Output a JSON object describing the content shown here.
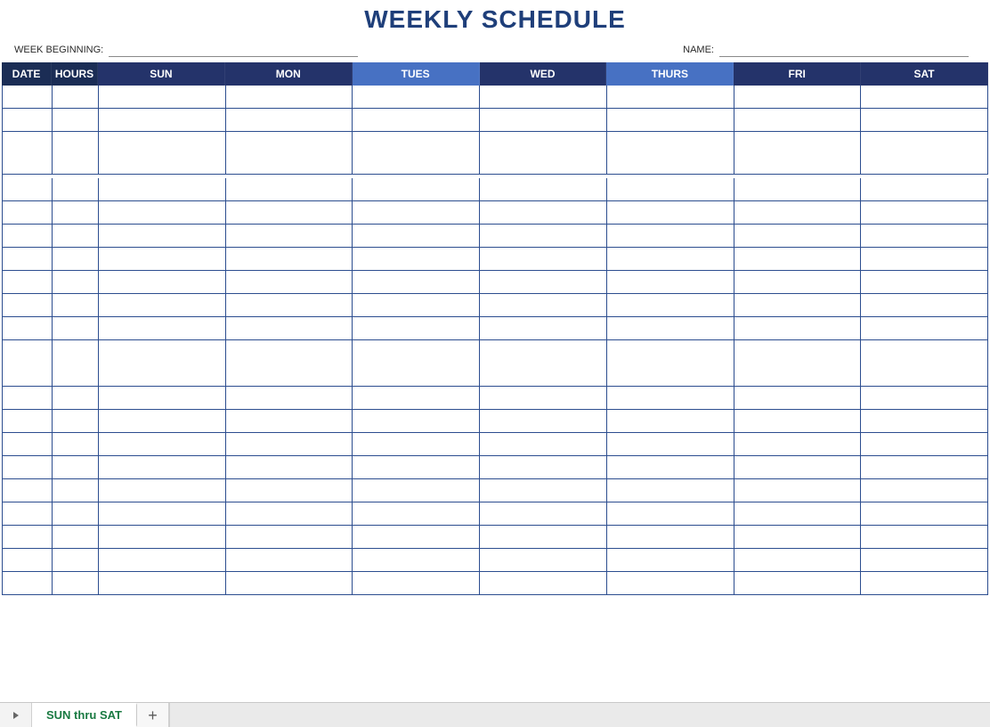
{
  "title": "WEEKLY SCHEDULE",
  "info": {
    "week_beginning_label": "WEEK BEGINNING:",
    "week_beginning_value": "",
    "name_label": "NAME:",
    "name_value": ""
  },
  "columns": {
    "date": "DATE",
    "hours": "HOURS",
    "sun": "SUN",
    "mon": "MON",
    "tues": "TUES",
    "wed": "WED",
    "thurs": "THURS",
    "fri": "FRI",
    "sat": "SAT"
  },
  "rows": [
    {
      "date": "",
      "hours": "",
      "sun": "",
      "mon": "",
      "tues": "",
      "wed": "",
      "thurs": "",
      "fri": "",
      "sat": ""
    },
    {
      "date": "",
      "hours": "",
      "sun": "",
      "mon": "",
      "tues": "",
      "wed": "",
      "thurs": "",
      "fri": "",
      "sat": ""
    },
    {
      "date": "",
      "hours": "",
      "sun": "",
      "mon": "",
      "tues": "",
      "wed": "",
      "thurs": "",
      "fri": "",
      "sat": ""
    },
    {
      "date": "",
      "hours": "",
      "sun": "",
      "mon": "",
      "tues": "",
      "wed": "",
      "thurs": "",
      "fri": "",
      "sat": ""
    },
    {
      "date": "",
      "hours": "",
      "sun": "",
      "mon": "",
      "tues": "",
      "wed": "",
      "thurs": "",
      "fri": "",
      "sat": ""
    },
    {
      "date": "",
      "hours": "",
      "sun": "",
      "mon": "",
      "tues": "",
      "wed": "",
      "thurs": "",
      "fri": "",
      "sat": ""
    },
    {
      "date": "",
      "hours": "",
      "sun": "",
      "mon": "",
      "tues": "",
      "wed": "",
      "thurs": "",
      "fri": "",
      "sat": ""
    },
    {
      "date": "",
      "hours": "",
      "sun": "",
      "mon": "",
      "tues": "",
      "wed": "",
      "thurs": "",
      "fri": "",
      "sat": ""
    },
    {
      "date": "",
      "hours": "",
      "sun": "",
      "mon": "",
      "tues": "",
      "wed": "",
      "thurs": "",
      "fri": "",
      "sat": ""
    },
    {
      "date": "",
      "hours": "",
      "sun": "",
      "mon": "",
      "tues": "",
      "wed": "",
      "thurs": "",
      "fri": "",
      "sat": ""
    },
    {
      "date": "",
      "hours": "",
      "sun": "",
      "mon": "",
      "tues": "",
      "wed": "",
      "thurs": "",
      "fri": "",
      "sat": ""
    },
    {
      "date": "",
      "hours": "",
      "sun": "",
      "mon": "",
      "tues": "",
      "wed": "",
      "thurs": "",
      "fri": "",
      "sat": ""
    },
    {
      "date": "",
      "hours": "",
      "sun": "",
      "mon": "",
      "tues": "",
      "wed": "",
      "thurs": "",
      "fri": "",
      "sat": ""
    },
    {
      "date": "",
      "hours": "",
      "sun": "",
      "mon": "",
      "tues": "",
      "wed": "",
      "thurs": "",
      "fri": "",
      "sat": ""
    },
    {
      "date": "",
      "hours": "",
      "sun": "",
      "mon": "",
      "tues": "",
      "wed": "",
      "thurs": "",
      "fri": "",
      "sat": ""
    },
    {
      "date": "",
      "hours": "",
      "sun": "",
      "mon": "",
      "tues": "",
      "wed": "",
      "thurs": "",
      "fri": "",
      "sat": ""
    },
    {
      "date": "",
      "hours": "",
      "sun": "",
      "mon": "",
      "tues": "",
      "wed": "",
      "thurs": "",
      "fri": "",
      "sat": ""
    },
    {
      "date": "",
      "hours": "",
      "sun": "",
      "mon": "",
      "tues": "",
      "wed": "",
      "thurs": "",
      "fri": "",
      "sat": ""
    },
    {
      "date": "",
      "hours": "",
      "sun": "",
      "mon": "",
      "tues": "",
      "wed": "",
      "thurs": "",
      "fri": "",
      "sat": ""
    },
    {
      "date": "",
      "hours": "",
      "sun": "",
      "mon": "",
      "tues": "",
      "wed": "",
      "thurs": "",
      "fri": "",
      "sat": ""
    },
    {
      "date": "",
      "hours": "",
      "sun": "",
      "mon": "",
      "tues": "",
      "wed": "",
      "thurs": "",
      "fri": "",
      "sat": ""
    },
    {
      "date": "",
      "hours": "",
      "sun": "",
      "mon": "",
      "tues": "",
      "wed": "",
      "thurs": "",
      "fri": "",
      "sat": ""
    }
  ],
  "tabs": {
    "active_sheet": "SUN thru SAT",
    "add_symbol": "+"
  }
}
